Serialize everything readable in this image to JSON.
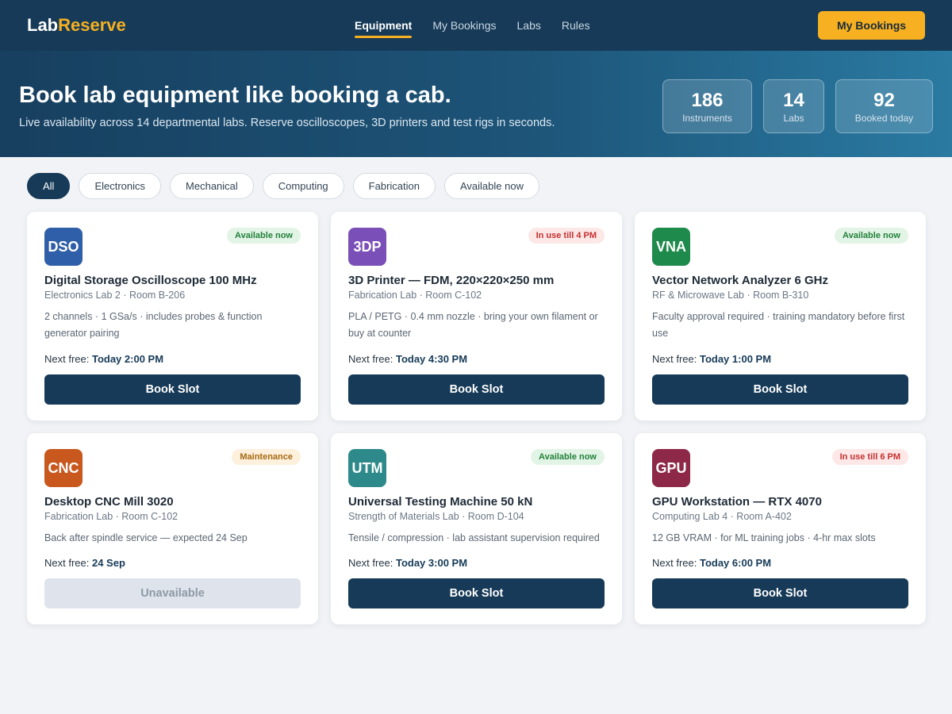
{
  "brand": {
    "part1": "Lab",
    "part2": "Reserve"
  },
  "nav": [
    {
      "label": "Equipment",
      "active": true
    },
    {
      "label": "My Bookings",
      "active": false
    },
    {
      "label": "Labs",
      "active": false
    },
    {
      "label": "Rules",
      "active": false
    }
  ],
  "top_cta": "My Bookings",
  "hero": {
    "title": "Book lab equipment like booking a cab.",
    "subtitle": "Live availability across 14 departmental labs. Reserve oscilloscopes, 3D printers and test rigs in seconds."
  },
  "stats": [
    {
      "value": "186",
      "label": "Instruments"
    },
    {
      "value": "14",
      "label": "Labs"
    },
    {
      "value": "92",
      "label": "Booked today"
    }
  ],
  "filters": [
    {
      "label": "All",
      "active": true
    },
    {
      "label": "Electronics",
      "active": false
    },
    {
      "label": "Mechanical",
      "active": false
    },
    {
      "label": "Computing",
      "active": false
    },
    {
      "label": "Fabrication",
      "active": false
    },
    {
      "label": "Available now",
      "active": false
    }
  ],
  "next_free_prefix": "Next free: ",
  "equipment": [
    {
      "code": "DSO",
      "icon_color": "#2f5fa8",
      "status": "Available now",
      "status_type": "avail",
      "name": "Digital Storage Oscilloscope 100 MHz",
      "location": "Electronics Lab 2 · Room B-206",
      "description": "2 channels · 1 GSa/s · includes probes & function generator pairing",
      "next_free": "Today 2:00 PM",
      "action": "Book Slot",
      "enabled": true
    },
    {
      "code": "3DP",
      "icon_color": "#7b4fb8",
      "status": "In use till 4 PM",
      "status_type": "inuse",
      "name": "3D Printer — FDM, 220×220×250 mm",
      "location": "Fabrication Lab · Room C-102",
      "description": "PLA / PETG · 0.4 mm nozzle · bring your own filament or buy at counter",
      "next_free": "Today 4:30 PM",
      "action": "Book Slot",
      "enabled": true
    },
    {
      "code": "VNA",
      "icon_color": "#1e8a4b",
      "status": "Available now",
      "status_type": "avail",
      "name": "Vector Network Analyzer 6 GHz",
      "location": "RF & Microwave Lab · Room B-310",
      "description": "Faculty approval required · training mandatory before first use",
      "next_free": "Today 1:00 PM",
      "action": "Book Slot",
      "enabled": true
    },
    {
      "code": "CNC",
      "icon_color": "#c8581e",
      "status": "Maintenance",
      "status_type": "maint",
      "name": "Desktop CNC Mill 3020",
      "location": "Fabrication Lab · Room C-102",
      "description": "Back after spindle service — expected 24 Sep",
      "next_free": "24 Sep",
      "action": "Unavailable",
      "enabled": false
    },
    {
      "code": "UTM",
      "icon_color": "#2e8a8a",
      "status": "Available now",
      "status_type": "avail",
      "name": "Universal Testing Machine 50 kN",
      "location": "Strength of Materials Lab · Room D-104",
      "description": "Tensile / compression · lab assistant supervision required",
      "next_free": "Today 3:00 PM",
      "action": "Book Slot",
      "enabled": true
    },
    {
      "code": "GPU",
      "icon_color": "#8e2848",
      "status": "In use till 6 PM",
      "status_type": "inuse",
      "name": "GPU Workstation — RTX 4070",
      "location": "Computing Lab 4 · Room A-402",
      "description": "12 GB VRAM · for ML training jobs · 4-hr max slots",
      "next_free": "Today 6:00 PM",
      "action": "Book Slot",
      "enabled": true
    }
  ]
}
